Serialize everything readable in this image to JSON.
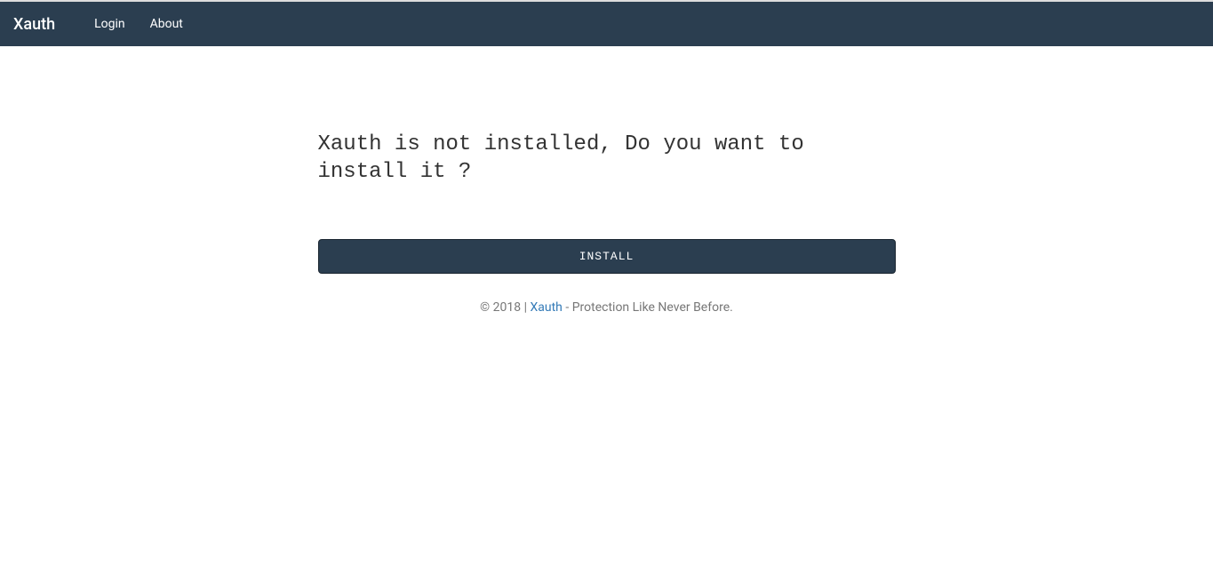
{
  "navbar": {
    "brand": "Xauth",
    "links": {
      "login": "Login",
      "about": "About"
    }
  },
  "main": {
    "message": "Xauth is not installed, Do you want to install it ?",
    "install_button": "INSTALL"
  },
  "footer": {
    "copyright_prefix": "© 2018 | ",
    "link_text": "Xauth",
    "tagline": " - Protection Like Never Before."
  }
}
